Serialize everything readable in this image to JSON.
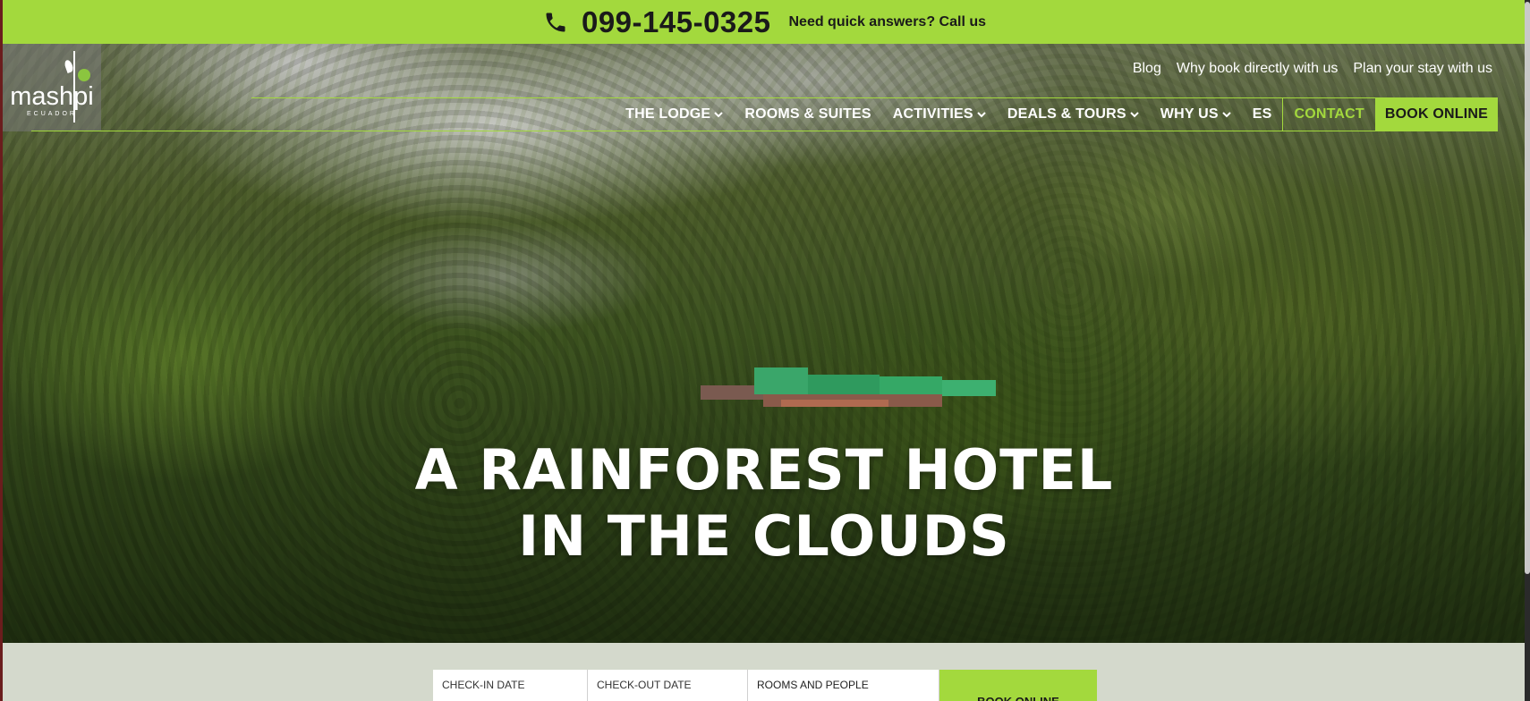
{
  "topbar": {
    "phone_icon": "phone-icon",
    "phone_number": "099-145-0325",
    "call_text": "Need quick answers? Call us",
    "background": "#a3d93d"
  },
  "logo": {
    "word": "mashpi",
    "sub": "ECUADOR"
  },
  "secondary_nav": {
    "items": [
      "Blog",
      "Why book directly with us",
      "Plan your stay with us"
    ]
  },
  "main_nav": {
    "items": [
      {
        "label": "THE LODGE",
        "has_dropdown": true
      },
      {
        "label": "ROOMS & SUITES",
        "has_dropdown": false
      },
      {
        "label": "ACTIVITIES",
        "has_dropdown": true
      },
      {
        "label": "DEALS & TOURS",
        "has_dropdown": true
      },
      {
        "label": "WHY US",
        "has_dropdown": true
      },
      {
        "label": "ES",
        "has_dropdown": false
      }
    ],
    "contact": "CONTACT",
    "book_online": "BOOK ONLINE",
    "accent": "#a3d93d"
  },
  "hero": {
    "title_line1": "A RAINFOREST HOTEL",
    "title_line2": "IN THE CLOUDS"
  },
  "booking": {
    "check_in": "CHECK-IN DATE",
    "check_out": "CHECK-OUT DATE",
    "rooms": "ROOMS AND PEOPLE",
    "submit": "BOOK ONLINE"
  }
}
